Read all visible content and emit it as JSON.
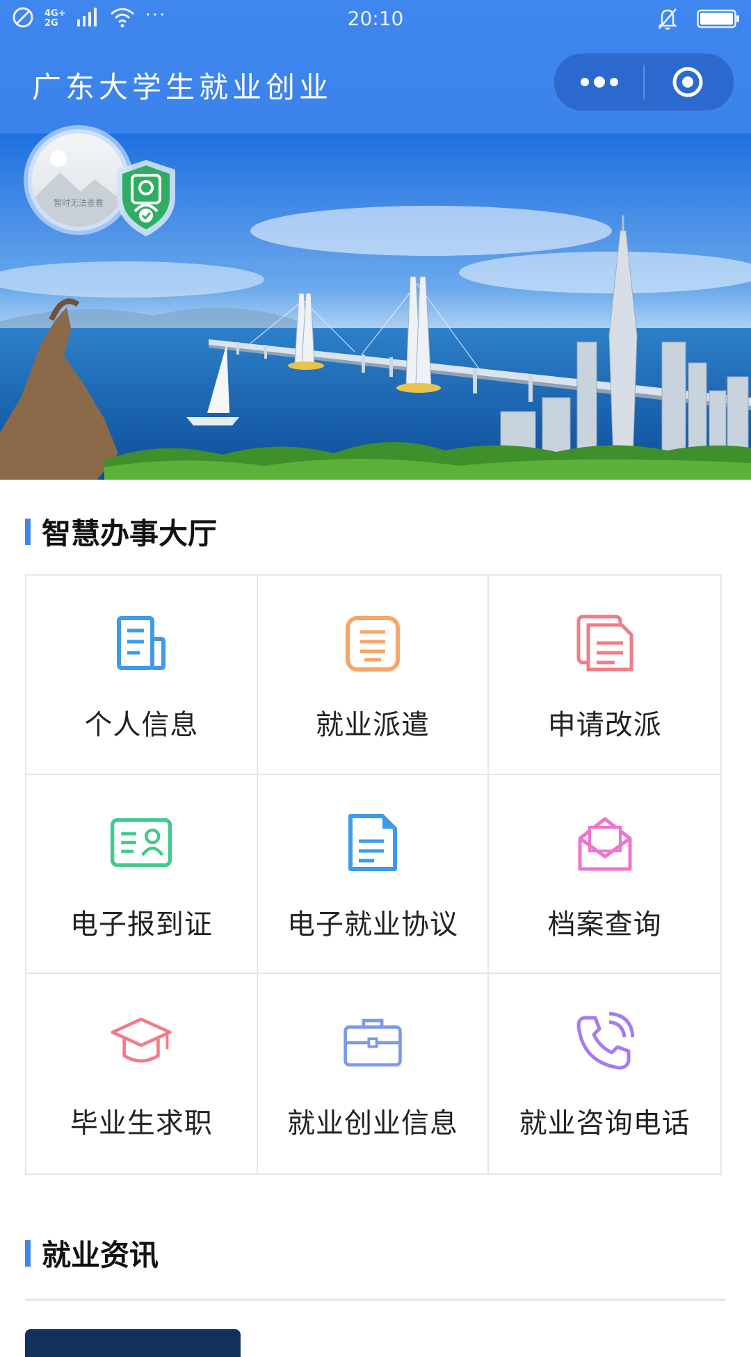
{
  "status_bar": {
    "network_top": "4G+",
    "network_bottom": "2G",
    "more": "···",
    "time": "20:10"
  },
  "title_bar": {
    "title": "广东大学生就业创业",
    "more_icon": "more-dots-icon",
    "close_icon": "target-circle-icon"
  },
  "banner": {
    "avatar_placeholder": "暂时无法查看",
    "badge_icon": "verified-shield-icon"
  },
  "service_hall": {
    "title": "智慧办事大厅",
    "items": [
      {
        "label": "个人信息",
        "icon": "document-icon",
        "color": "#3f9ae8"
      },
      {
        "label": "就业派遣",
        "icon": "clipboard-icon",
        "color": "#f8a56a"
      },
      {
        "label": "申请改派",
        "icon": "files-icon",
        "color": "#f07d86"
      },
      {
        "label": "电子报到证",
        "icon": "id-card-icon",
        "color": "#3fcb8b"
      },
      {
        "label": "电子就业协议",
        "icon": "agreement-doc-icon",
        "color": "#3f9ae8"
      },
      {
        "label": "档案查询",
        "icon": "envelope-icon",
        "color": "#ee74cf"
      },
      {
        "label": "毕业生求职",
        "icon": "graduation-cap-icon",
        "color": "#f07d86"
      },
      {
        "label": "就业创业信息",
        "icon": "briefcase-icon",
        "color": "#7c9ae6"
      },
      {
        "label": "就业咨询电话",
        "icon": "phone-icon",
        "color": "#a57cf0"
      }
    ]
  },
  "news": {
    "title": "就业资讯"
  }
}
